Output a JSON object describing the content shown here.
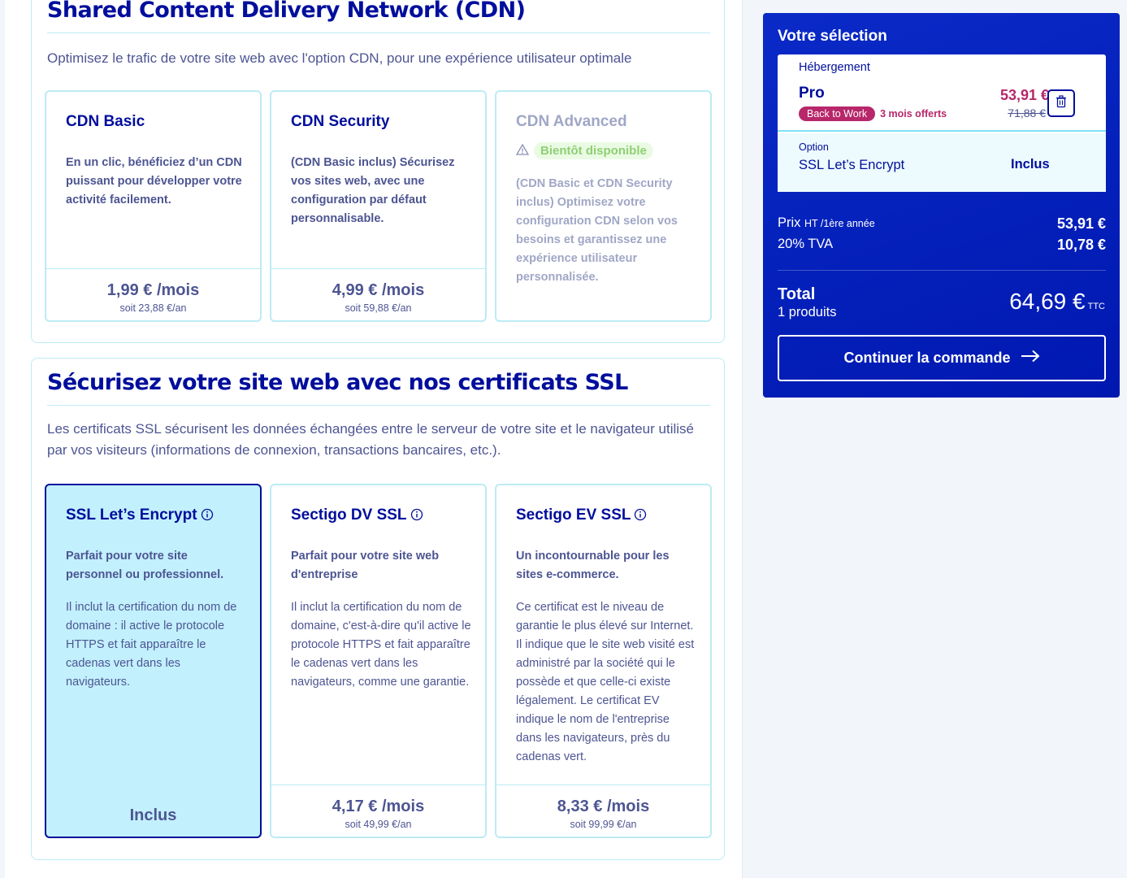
{
  "cdn": {
    "title": "Shared Content Delivery Network (CDN)",
    "description": "Optimisez le trafic de votre site web avec l'option CDN, pour une expérience utilisateur optimale",
    "cards": [
      {
        "name": "CDN Basic",
        "lead": "En un clic, bénéficiez d’un CDN puissant pour développer votre activité facilement.",
        "price": "1,99 € /mois",
        "yearly": "soit 23,88 €/an"
      },
      {
        "name": "CDN Security",
        "lead": "(CDN Basic inclus) Sécurisez vos sites web, avec une configuration par défaut personnalisable.",
        "price": "4,99 € /mois",
        "yearly": "soit 59,88 €/an"
      },
      {
        "name": "CDN Advanced",
        "badge": "Bientôt disponible",
        "lead": "(CDN Basic et CDN Security inclus) Optimisez votre configuration CDN selon vos besoins et garantissez une expérience utilisateur personnalisée."
      }
    ]
  },
  "ssl": {
    "title": "Sécurisez votre site web avec nos certificats SSL",
    "description": "Les certificats SSL sécurisent les données échangées entre le serveur de votre site et le navigateur utilisé par vos visiteurs (informations de connexion, transactions bancaires, etc.).",
    "cards": [
      {
        "name": "SSL Let’s Encrypt",
        "lead": "Parfait pour votre site personnel ou professionnel.",
        "body": "Il inclut la certification du nom de domaine : il active le protocole HTTPS et fait apparaître le cadenas vert dans les navigateurs.",
        "included": "Inclus"
      },
      {
        "name": "Sectigo DV SSL",
        "lead": "Parfait pour votre site web d'entreprise",
        "body": "Il inclut la certification du nom de domaine, c'est-à-dire qu'il active le protocole HTTPS et fait apparaître le cadenas vert dans les navigateurs, comme une garantie.",
        "price": "4,17 € /mois",
        "yearly": "soit 49,99 €/an"
      },
      {
        "name": "Sectigo EV SSL",
        "lead": "Un incontournable pour les sites e-commerce.",
        "body": "Ce certificat est le niveau de garantie le plus élevé sur Internet. Il indique que le site web visité est administré par la société qui le possède et que celle-ci existe légalement. Le certificat EV indique le nom de l'entreprise dans les navigateurs, près du cadenas vert.",
        "price": "8,33 € /mois",
        "yearly": "soit 99,99 €/an"
      }
    ]
  },
  "cart": {
    "title": "Votre sélection",
    "item": {
      "category": "Hébergement",
      "name": "Pro",
      "promo_badge": "Back to Work",
      "promo_text": "3 mois offerts",
      "price": "53,91 €",
      "old_price": "71,88 €"
    },
    "option": {
      "category": "Option",
      "name": "SSL Let’s Encrypt",
      "value": "Inclus"
    },
    "price_label": "Prix",
    "price_label_small": "HT /1ère année",
    "price_value": "53,91 €",
    "tva_label": "20% TVA",
    "tva_value": "10,78 €",
    "total_label": "Total",
    "total_count": "1 produits",
    "total_value": "64,69 €",
    "total_suffix": "TTC",
    "cta_label": "Continuer la commande"
  },
  "colors": {
    "brand_blue": "#000e9c",
    "cart_blue": "#0a2ac7",
    "accent_cyan": "#bdebf5",
    "selected_bg": "#c2f0fd",
    "promo_pink": "#b7276a"
  }
}
